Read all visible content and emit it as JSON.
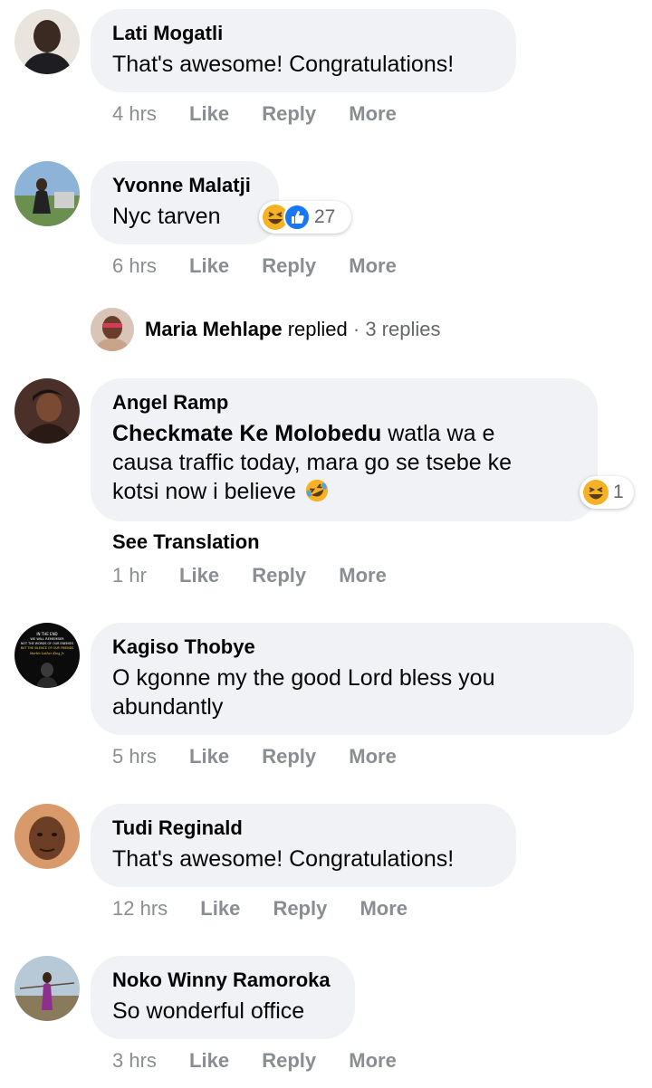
{
  "comments": [
    {
      "author": "Lati Mogatli",
      "text": "That's awesome! Congratulations!",
      "time": "4 hrs",
      "actions": {
        "like": "Like",
        "reply": "Reply",
        "more": "More"
      }
    },
    {
      "author": "Yvonne Malatji",
      "text": "Nyc tarven",
      "time": "6 hrs",
      "reactions": {
        "icons": [
          "haha-icon",
          "like-icon"
        ],
        "count": "27"
      },
      "actions": {
        "like": "Like",
        "reply": "Reply",
        "more": "More"
      }
    },
    {
      "author": "Angel Ramp",
      "mention": "Checkmate Ke Molobedu",
      "text_line1": " watla wa e",
      "text_line2": "causa traffic today, mara go se tsebe ke",
      "text_line3": "kotsi now i believe",
      "inline_emoji": "rolling-laughing-icon",
      "reactions": {
        "icons": [
          "haha-icon"
        ],
        "count": "1"
      },
      "see_translation": "See Translation",
      "time": "1 hr",
      "actions": {
        "like": "Like",
        "reply": "Reply",
        "more": "More"
      }
    },
    {
      "author": "Kagiso Thobye",
      "text_line1": "O kgonne my the good Lord bless you",
      "text_line2": "abundantly",
      "time": "5 hrs",
      "avatar_text": [
        "IN THE END",
        "WE WILL REMEMBER",
        "NOT THE WORDS OF OUR ENEMIES",
        "BUT THE SILENCE OF OUR FRIENDS",
        "Martin Luther King Jr."
      ],
      "actions": {
        "like": "Like",
        "reply": "Reply",
        "more": "More"
      }
    },
    {
      "author": "Tudi Reginald",
      "text": "That's awesome! Congratulations!",
      "time": "12 hrs",
      "actions": {
        "like": "Like",
        "reply": "Reply",
        "more": "More"
      }
    },
    {
      "author": "Noko Winny Ramoroka",
      "text": "So wonderful office",
      "time": "3 hrs",
      "actions": {
        "like": "Like",
        "reply": "Reply",
        "more": "More"
      }
    }
  ],
  "replies_summary": {
    "name": "Maria Mehlape",
    "verb": " replied",
    "count": " · 3 replies"
  },
  "colors": {
    "bubble": "#f0f2f5",
    "meta": "#8a8d91",
    "like_blue": "#1877f2",
    "haha_yellow": "#f7b125"
  }
}
